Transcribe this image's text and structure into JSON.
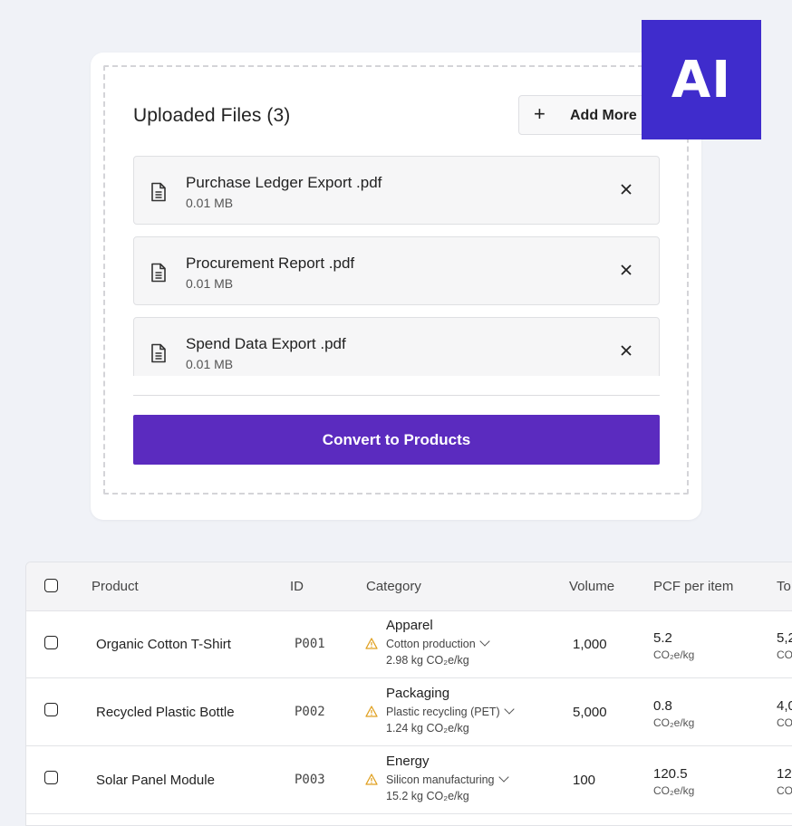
{
  "upload_card": {
    "title": "Uploaded Files (3)",
    "add_more_label": "Add More",
    "files": [
      {
        "name": "Purchase Ledger Export .pdf",
        "size": "0.01 MB"
      },
      {
        "name": "Procurement Report .pdf",
        "size": "0.01 MB"
      },
      {
        "name": "Spend Data Export .pdf",
        "size": "0.01 MB"
      }
    ],
    "convert_label": "Convert to Products"
  },
  "ai_badge": {
    "text": "AI",
    "color": "#3f2ccc"
  },
  "accent_color": "#5b2bbf",
  "table": {
    "headers": {
      "product": "Product",
      "id": "ID",
      "category": "Category",
      "volume": "Volume",
      "pcf": "PCF per item",
      "total": "To"
    },
    "rows": [
      {
        "product": "Organic Cotton T-Shirt",
        "id": "P001",
        "category": "Apparel",
        "process": "Cotton production",
        "emission_factor": "2.98 kg CO₂e/kg",
        "volume": "1,000",
        "pcf": "5.2",
        "pcf_unit": "CO₂e/kg",
        "total": "5,2",
        "total_unit": "CO"
      },
      {
        "product": "Recycled Plastic Bottle",
        "id": "P002",
        "category": "Packaging",
        "process": "Plastic recycling (PET)",
        "emission_factor": "1.24 kg CO₂e/kg",
        "volume": "5,000",
        "pcf": "0.8",
        "pcf_unit": "CO₂e/kg",
        "total": "4,0",
        "total_unit": "CO"
      },
      {
        "product": "Solar Panel Module",
        "id": "P003",
        "category": "Energy",
        "process": "Silicon manufacturing",
        "emission_factor": "15.2 kg CO₂e/kg",
        "volume": "100",
        "pcf": "120.5",
        "pcf_unit": "CO₂e/kg",
        "total": "12,",
        "total_unit": "CO"
      }
    ]
  }
}
